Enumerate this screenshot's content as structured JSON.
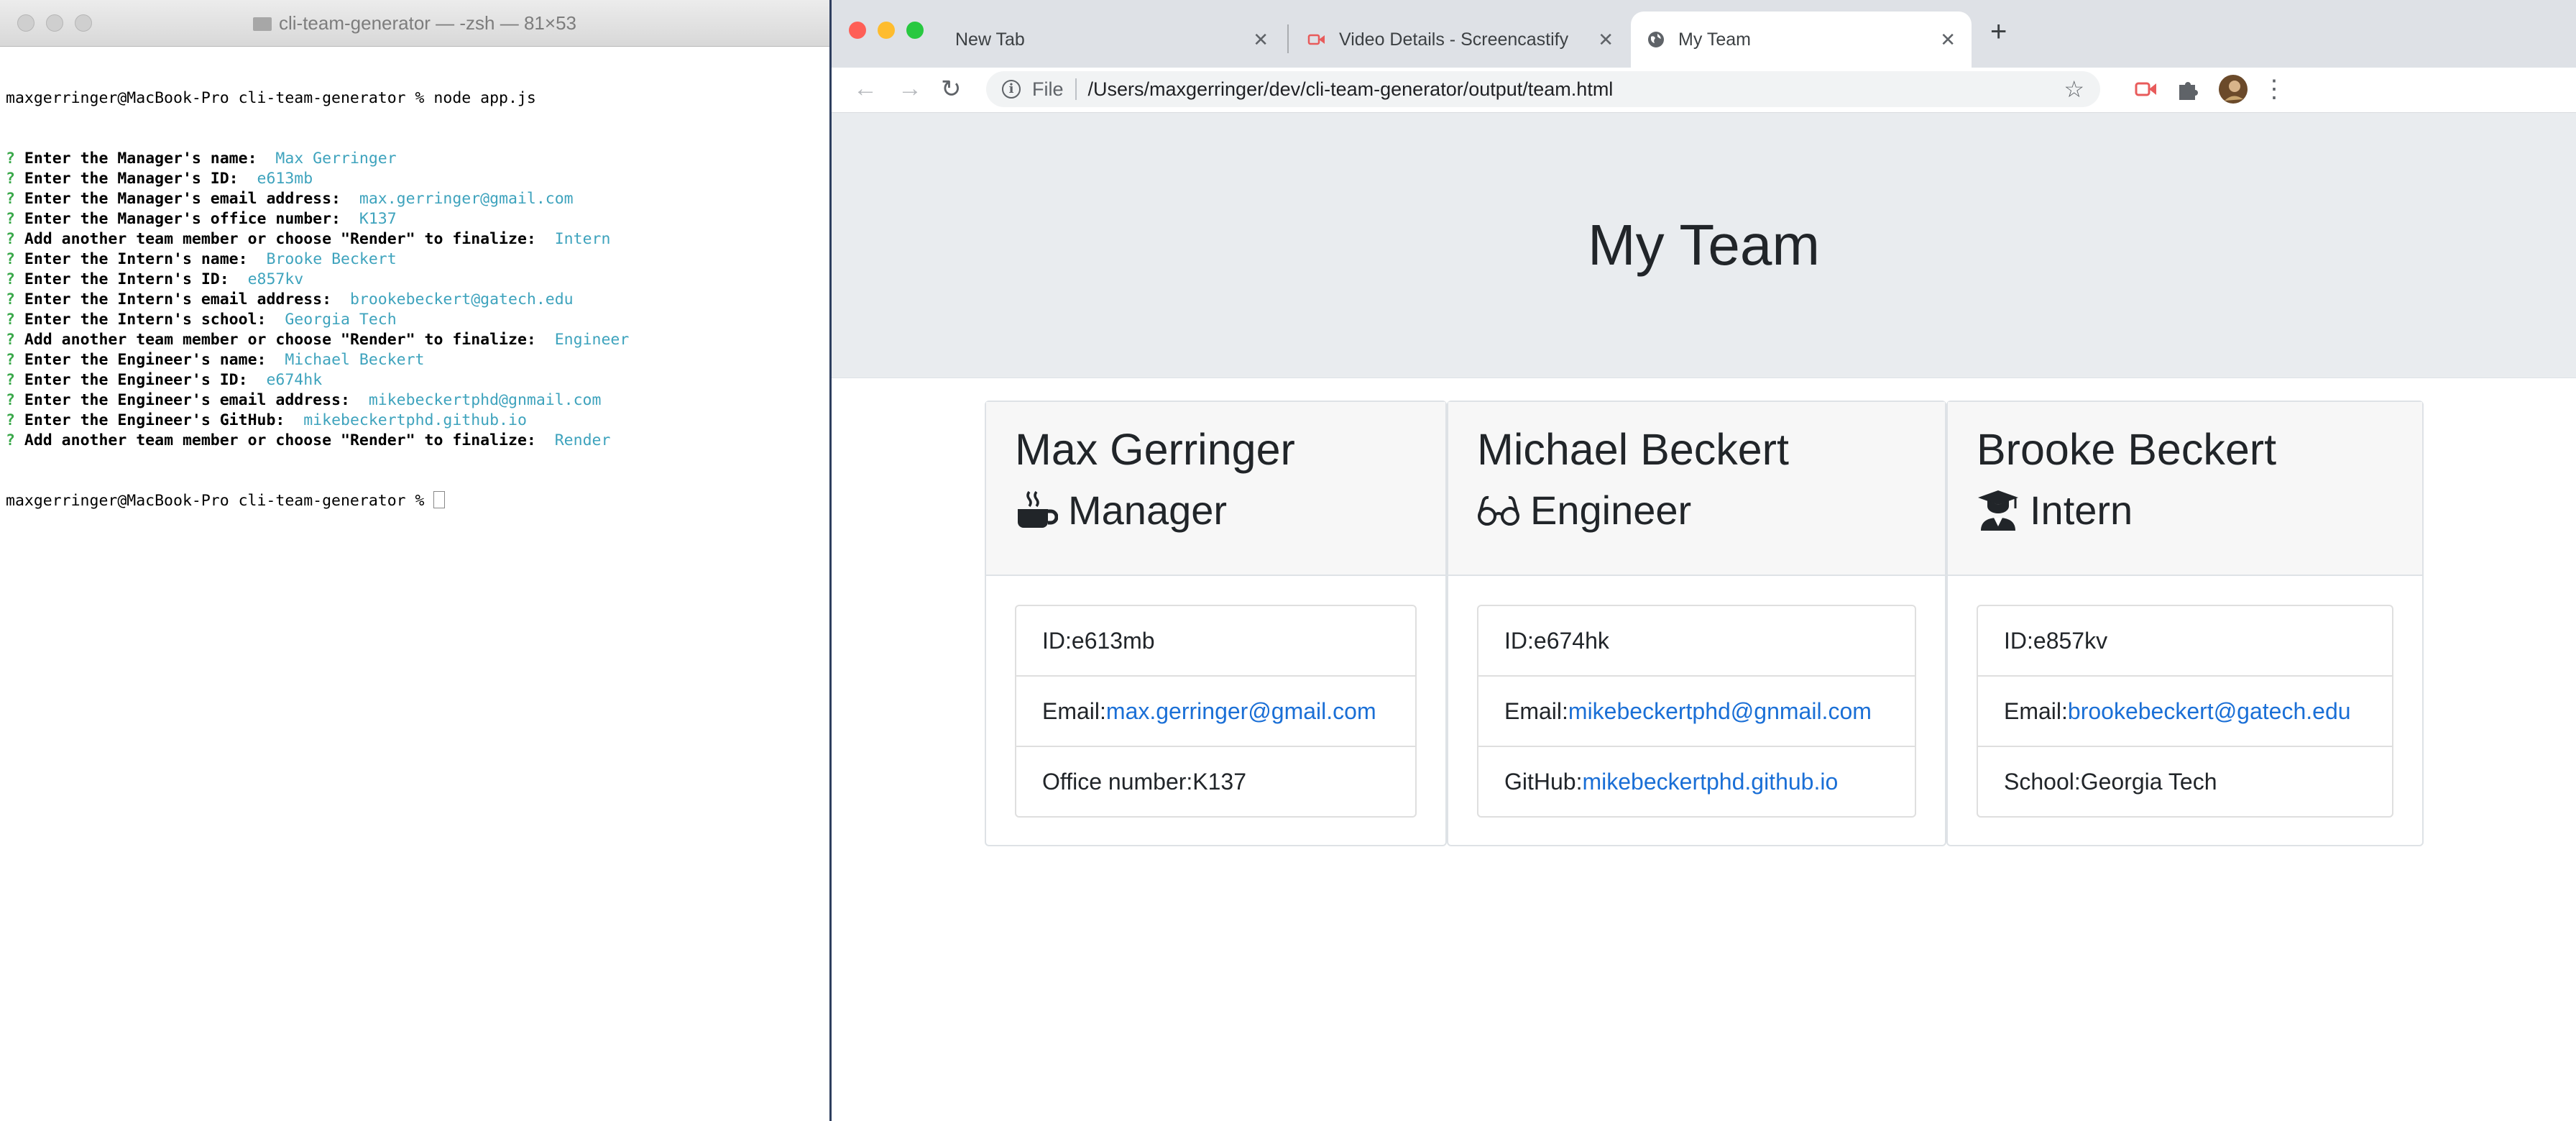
{
  "terminal": {
    "title": "cli-team-generator — -zsh — 81×53",
    "first_line": "maxgerringer@MacBook-Pro cli-team-generator % node app.js",
    "prompt_lines": [
      {
        "q": "?",
        "prompt": "Enter the Manager's name:",
        "answer": "Max Gerringer"
      },
      {
        "q": "?",
        "prompt": "Enter the Manager's ID:",
        "answer": "e613mb"
      },
      {
        "q": "?",
        "prompt": "Enter the Manager's email address:",
        "answer": "max.gerringer@gmail.com"
      },
      {
        "q": "?",
        "prompt": "Enter the Manager's office number:",
        "answer": "K137"
      },
      {
        "q": "?",
        "prompt": "Add another team member or choose \"Render\" to finalize:",
        "answer": "Intern"
      },
      {
        "q": "?",
        "prompt": "Enter the Intern's name:",
        "answer": "Brooke Beckert"
      },
      {
        "q": "?",
        "prompt": "Enter the Intern's ID:",
        "answer": "e857kv"
      },
      {
        "q": "?",
        "prompt": "Enter the Intern's email address:",
        "answer": "brookebeckert@gatech.edu"
      },
      {
        "q": "?",
        "prompt": "Enter the Intern's school:",
        "answer": "Georgia Tech"
      },
      {
        "q": "?",
        "prompt": "Add another team member or choose \"Render\" to finalize:",
        "answer": "Engineer"
      },
      {
        "q": "?",
        "prompt": "Enter the Engineer's name:",
        "answer": "Michael Beckert"
      },
      {
        "q": "?",
        "prompt": "Enter the Engineer's ID:",
        "answer": "e674hk"
      },
      {
        "q": "?",
        "prompt": "Enter the Engineer's email address:",
        "answer": "mikebeckertphd@gnmail.com"
      },
      {
        "q": "?",
        "prompt": "Enter the Engineer's GitHub:",
        "answer": "mikebeckertphd.github.io"
      },
      {
        "q": "?",
        "prompt": "Add another team member or choose \"Render\" to finalize:",
        "answer": "Render"
      }
    ],
    "last_line": "maxgerringer@MacBook-Pro cli-team-generator % "
  },
  "browser": {
    "tabs": [
      {
        "label": "New Tab"
      },
      {
        "label": "Video Details - Screencastify"
      },
      {
        "label": "My Team"
      }
    ],
    "address": {
      "scheme": "File",
      "path": "/Users/maxgerringer/dev/cli-team-generator/output/team.html"
    },
    "accent_colors": {
      "link": "#1a6fd6",
      "jumbotron": "#e9ecef",
      "terminal_answer": "#3ea3bd",
      "terminal_q": "#3aa84a"
    }
  },
  "page": {
    "heading": "My Team",
    "cards": [
      {
        "name": "Max Gerringer",
        "role": "Manager",
        "icon": "mug-icon",
        "id_label": "ID: ",
        "id": "e613mb",
        "email_label": "Email: ",
        "email": "max.gerringer@gmail.com",
        "extra_label": "Office number: ",
        "extra": "K137",
        "extra_is_link": false
      },
      {
        "name": "Michael Beckert",
        "role": "Engineer",
        "icon": "glasses-icon",
        "id_label": "ID: ",
        "id": "e674hk",
        "email_label": "Email: ",
        "email": "mikebeckertphd@gnmail.com",
        "extra_label": "GitHub: ",
        "extra": "mikebeckertphd.github.io",
        "extra_is_link": true
      },
      {
        "name": "Brooke Beckert",
        "role": "Intern",
        "icon": "graduate-icon",
        "id_label": "ID: ",
        "id": "e857kv",
        "email_label": "Email: ",
        "email": "brookebeckert@gatech.edu",
        "extra_label": "School: ",
        "extra": "Georgia Tech",
        "extra_is_link": false
      }
    ]
  }
}
